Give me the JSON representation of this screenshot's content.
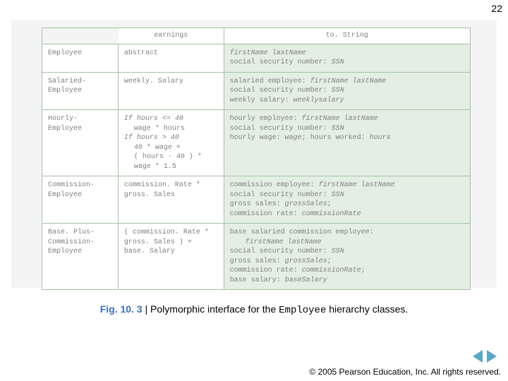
{
  "page_number": "22",
  "table": {
    "headers": {
      "c1": "",
      "c2": "earnings",
      "c3": "to. String"
    },
    "rows": [
      {
        "class_name": "Employee",
        "earnings_html": "abstract",
        "tostring_html": "<i>firstName lastName</i><br>social security number: <i>SSN</i>"
      },
      {
        "class_name": "Salaried-<br>Employee",
        "earnings_html": "weekly. Salary",
        "tostring_html": "salaried employee: <i>firstName lastName</i><br>social security number: <i>SSN</i><br>weekly salary: <i>weeklysalary</i>"
      },
      {
        "class_name": "Hourly-<br>Employee",
        "earnings_html": "<i>If hours &lt;= 40</i><br><span class=\"indent\">wage * hours</span><i>If hours &gt; 40</i><br><span class=\"indent\">40 * wage +</span><span class=\"indent\">( hours - 40 ) *</span><span class=\"indent\">wage * 1.5</span>",
        "tostring_html": "hourly employee: <i>firstName lastName</i><br>social security number: <i>SSN</i><br>hourly wage: <i>wage</i>; hours worked: <i>hours</i>"
      },
      {
        "class_name": "Commission-<br>Employee",
        "earnings_html": "commission. Rate *<br>gross. Sales",
        "tostring_html": "commission employee: <i>firstName lastName</i><br>social security number: <i>SSN</i><br>gross sales: <i>grossSales</i>;<br>commission rate: <i>commissionRate</i>"
      },
      {
        "class_name": "Base. Plus-<br>Commission-<br>Employee",
        "earnings_html": "( commission. Rate *<br>gross. Sales ) +<br>base. Salary",
        "tostring_html": "base salaried commission employee:<br><span class=\"indent2\"><i>firstName lastName</i></span>social security number: <i>SSN</i><br>gross sales: <i>grossSales</i>;<br>commission rate: <i>commissionRate</i>;<br>base salary: <i>baseSalary</i>"
      }
    ]
  },
  "caption": {
    "fignum": "Fig. 10. 3",
    "sep": " | ",
    "pre": "Polymorphic interface for the ",
    "code": "Employee",
    "post": " hierarchy classes."
  },
  "copyright": "© 2005 Pearson Education, Inc. All rights reserved."
}
